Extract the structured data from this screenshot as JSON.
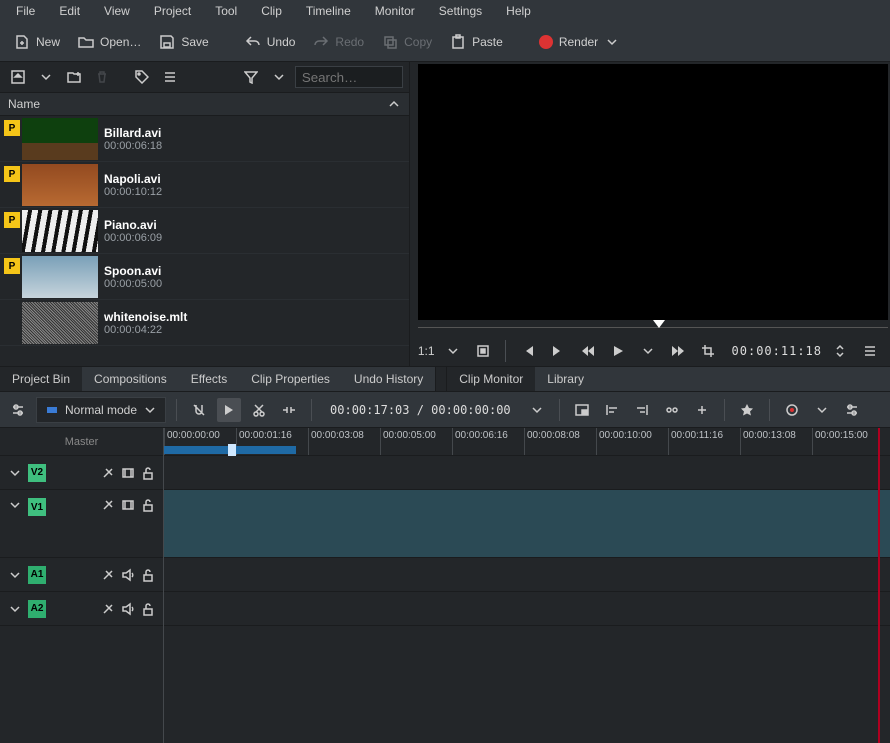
{
  "menu": {
    "items": [
      "File",
      "Edit",
      "View",
      "Project",
      "Tool",
      "Clip",
      "Timeline",
      "Monitor",
      "Settings",
      "Help"
    ]
  },
  "toolbar": {
    "new": "New",
    "open": "Open…",
    "save": "Save",
    "undo": "Undo",
    "redo": "Redo",
    "copy": "Copy",
    "paste": "Paste",
    "render": "Render"
  },
  "bin": {
    "search_placeholder": "Search…",
    "name_header": "Name",
    "clips": [
      {
        "name": "Billard.avi",
        "dur": "00:00:06:18",
        "thumb": "billiard",
        "proxy": true
      },
      {
        "name": "Napoli.avi",
        "dur": "00:00:10:12",
        "thumb": "napoli",
        "proxy": true
      },
      {
        "name": "Piano.avi",
        "dur": "00:00:06:09",
        "thumb": "piano",
        "proxy": true
      },
      {
        "name": "Spoon.avi",
        "dur": "00:00:05:00",
        "thumb": "spoon",
        "proxy": true
      },
      {
        "name": "whitenoise.mlt",
        "dur": "00:00:04:22",
        "thumb": "noise",
        "proxy": false
      }
    ]
  },
  "panel_tabs": {
    "left": [
      "Project Bin",
      "Compositions",
      "Effects",
      "Clip Properties",
      "Undo History"
    ],
    "left_active": 0,
    "right": [
      "Clip Monitor",
      "Library"
    ],
    "right_active": 0
  },
  "monitor": {
    "zoom": "1:1",
    "timecode": "00:00:11:18"
  },
  "timeline_toolbar": {
    "mode": "Normal mode",
    "timecode": "00:00:17:03 / 00:00:00:00"
  },
  "timeline": {
    "master": "Master",
    "ticks": [
      "00:00:00:00",
      "00:00:01:16",
      "00:00:03:08",
      "00:00:05:00",
      "00:00:06:16",
      "00:00:08:08",
      "00:00:10:00",
      "00:00:11:16",
      "00:00:13:08",
      "00:00:15:00"
    ],
    "tracks": [
      {
        "id": "V2",
        "type": "video",
        "size": "small"
      },
      {
        "id": "V1",
        "type": "video",
        "size": "big",
        "hilite": true
      },
      {
        "id": "A1",
        "type": "audio",
        "size": "small"
      },
      {
        "id": "A2",
        "type": "audio",
        "size": "small"
      }
    ]
  }
}
